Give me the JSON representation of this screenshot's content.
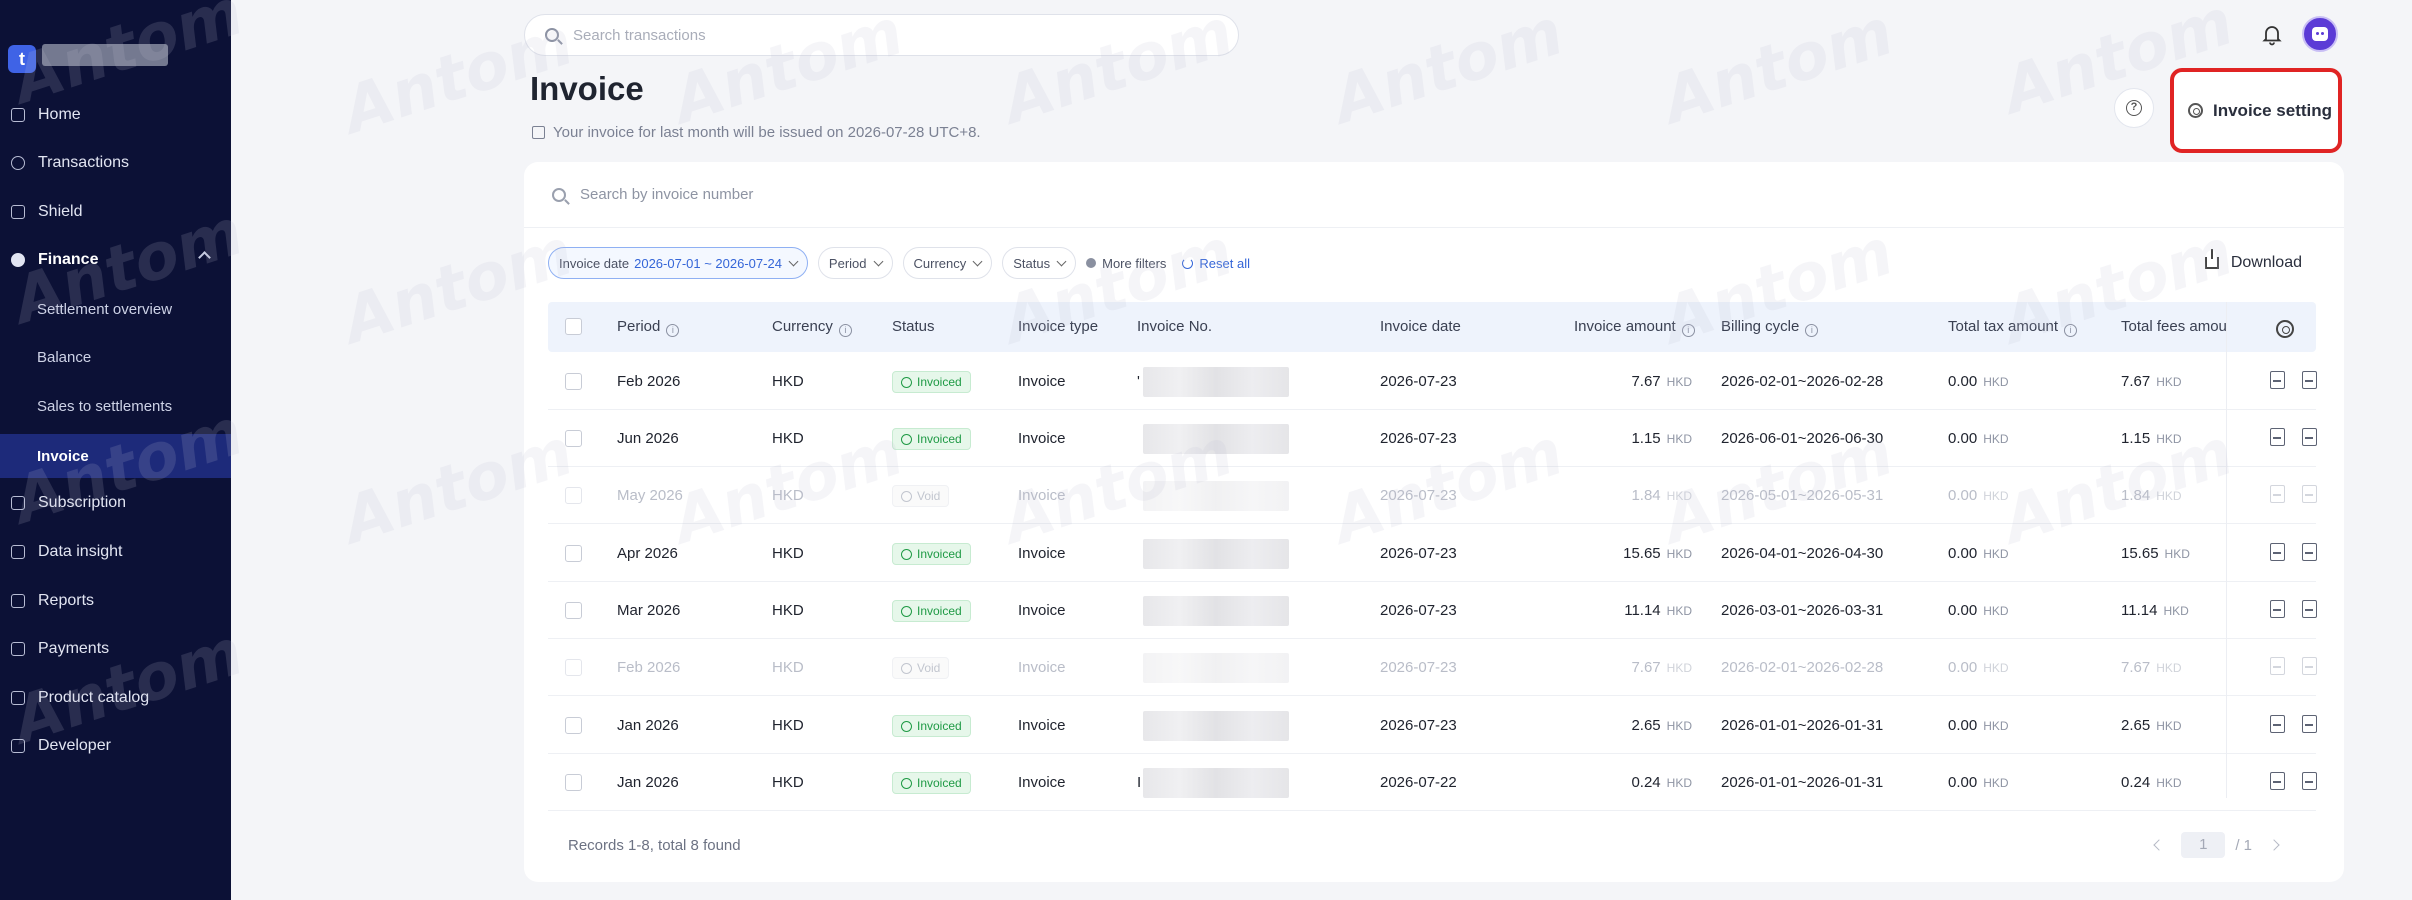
{
  "sidebar": {
    "logo_letter": "t",
    "items": [
      {
        "label": "Home",
        "icon": "home-icon"
      },
      {
        "label": "Transactions",
        "icon": "transactions-icon"
      },
      {
        "label": "Shield",
        "icon": "shield-icon"
      },
      {
        "label": "Finance",
        "icon": "finance-icon"
      },
      {
        "label": "Settlement overview"
      },
      {
        "label": "Balance"
      },
      {
        "label": "Sales to settlements"
      },
      {
        "label": "Invoice"
      },
      {
        "label": "Subscription",
        "icon": "subscription-icon"
      },
      {
        "label": "Data insight",
        "icon": "chart-icon"
      },
      {
        "label": "Reports",
        "icon": "reports-icon"
      },
      {
        "label": "Payments",
        "icon": "payments-icon"
      },
      {
        "label": "Product catalog",
        "icon": "grid-icon"
      },
      {
        "label": "Developer",
        "icon": "developer-icon"
      }
    ]
  },
  "top": {
    "search_placeholder": "Search transactions"
  },
  "header": {
    "title": "Invoice",
    "subtitle": "Your invoice for last month will be issued on 2026-07-28 UTC+8.",
    "setting_label": "Invoice setting"
  },
  "search": {
    "placeholder": "Search by invoice number"
  },
  "filters": {
    "invoice_date_label": "Invoice date",
    "invoice_date_value": "2026-07-01 ~ 2026-07-24",
    "period": "Period",
    "currency": "Currency",
    "status": "Status",
    "more": "More filters",
    "reset": "Reset all",
    "download": "Download"
  },
  "table": {
    "headers": [
      "Period",
      "Currency",
      "Status",
      "Invoice type",
      "Invoice No.",
      "Invoice date",
      "Invoice amount",
      "Billing cycle",
      "Total tax amount",
      "Total fees amou"
    ],
    "rows": [
      {
        "period": "Feb 2026",
        "currency": "HKD",
        "status": "Invoiced",
        "type": "Invoice",
        "no_prefix": "'",
        "date": "2026-07-23",
        "amount": "7.67",
        "amount_cur": "HKD",
        "cycle": "2026-02-01~2026-02-28",
        "tax": "0.00",
        "tax_cur": "HKD",
        "fees": "7.67",
        "fees_cur": "HKD",
        "void": false
      },
      {
        "period": "Jun 2026",
        "currency": "HKD",
        "status": "Invoiced",
        "type": "Invoice",
        "no_prefix": "",
        "date": "2026-07-23",
        "amount": "1.15",
        "amount_cur": "HKD",
        "cycle": "2026-06-01~2026-06-30",
        "tax": "0.00",
        "tax_cur": "HKD",
        "fees": "1.15",
        "fees_cur": "HKD",
        "void": false
      },
      {
        "period": "May 2026",
        "currency": "HKD",
        "status": "Void",
        "type": "Invoice",
        "no_prefix": "",
        "date": "2026-07-23",
        "amount": "1.84",
        "amount_cur": "HKD",
        "cycle": "2026-05-01~2026-05-31",
        "tax": "0.00",
        "tax_cur": "HKD",
        "fees": "1.84",
        "fees_cur": "HKD",
        "void": true
      },
      {
        "period": "Apr 2026",
        "currency": "HKD",
        "status": "Invoiced",
        "type": "Invoice",
        "no_prefix": "",
        "date": "2026-07-23",
        "amount": "15.65",
        "amount_cur": "HKD",
        "cycle": "2026-04-01~2026-04-30",
        "tax": "0.00",
        "tax_cur": "HKD",
        "fees": "15.65",
        "fees_cur": "HKD",
        "void": false
      },
      {
        "period": "Mar 2026",
        "currency": "HKD",
        "status": "Invoiced",
        "type": "Invoice",
        "no_prefix": "",
        "date": "2026-07-23",
        "amount": "11.14",
        "amount_cur": "HKD",
        "cycle": "2026-03-01~2026-03-31",
        "tax": "0.00",
        "tax_cur": "HKD",
        "fees": "11.14",
        "fees_cur": "HKD",
        "void": false
      },
      {
        "period": "Feb 2026",
        "currency": "HKD",
        "status": "Void",
        "type": "Invoice",
        "no_prefix": "",
        "date": "2026-07-23",
        "amount": "7.67",
        "amount_cur": "HKD",
        "cycle": "2026-02-01~2026-02-28",
        "tax": "0.00",
        "tax_cur": "HKD",
        "fees": "7.67",
        "fees_cur": "HKD",
        "void": true
      },
      {
        "period": "Jan 2026",
        "currency": "HKD",
        "status": "Invoiced",
        "type": "Invoice",
        "no_prefix": "",
        "date": "2026-07-23",
        "amount": "2.65",
        "amount_cur": "HKD",
        "cycle": "2026-01-01~2026-01-31",
        "tax": "0.00",
        "tax_cur": "HKD",
        "fees": "2.65",
        "fees_cur": "HKD",
        "void": false
      },
      {
        "period": "Jan 2026",
        "currency": "HKD",
        "status": "Invoiced",
        "type": "Invoice",
        "no_prefix": "I",
        "date": "2026-07-22",
        "amount": "0.24",
        "amount_cur": "HKD",
        "cycle": "2026-01-01~2026-01-31",
        "tax": "0.00",
        "tax_cur": "HKD",
        "fees": "0.24",
        "fees_cur": "HKD",
        "void": false
      }
    ]
  },
  "footer": {
    "records": "Records 1-8, total 8 found",
    "page": "1",
    "total_pages": "/ 1"
  },
  "watermark": "Antom",
  "colors": {
    "sidebar_bg": "#0c1136",
    "accent": "#3566d8",
    "highlight_border": "#e02424",
    "status_invoiced": "#1f9a45"
  }
}
